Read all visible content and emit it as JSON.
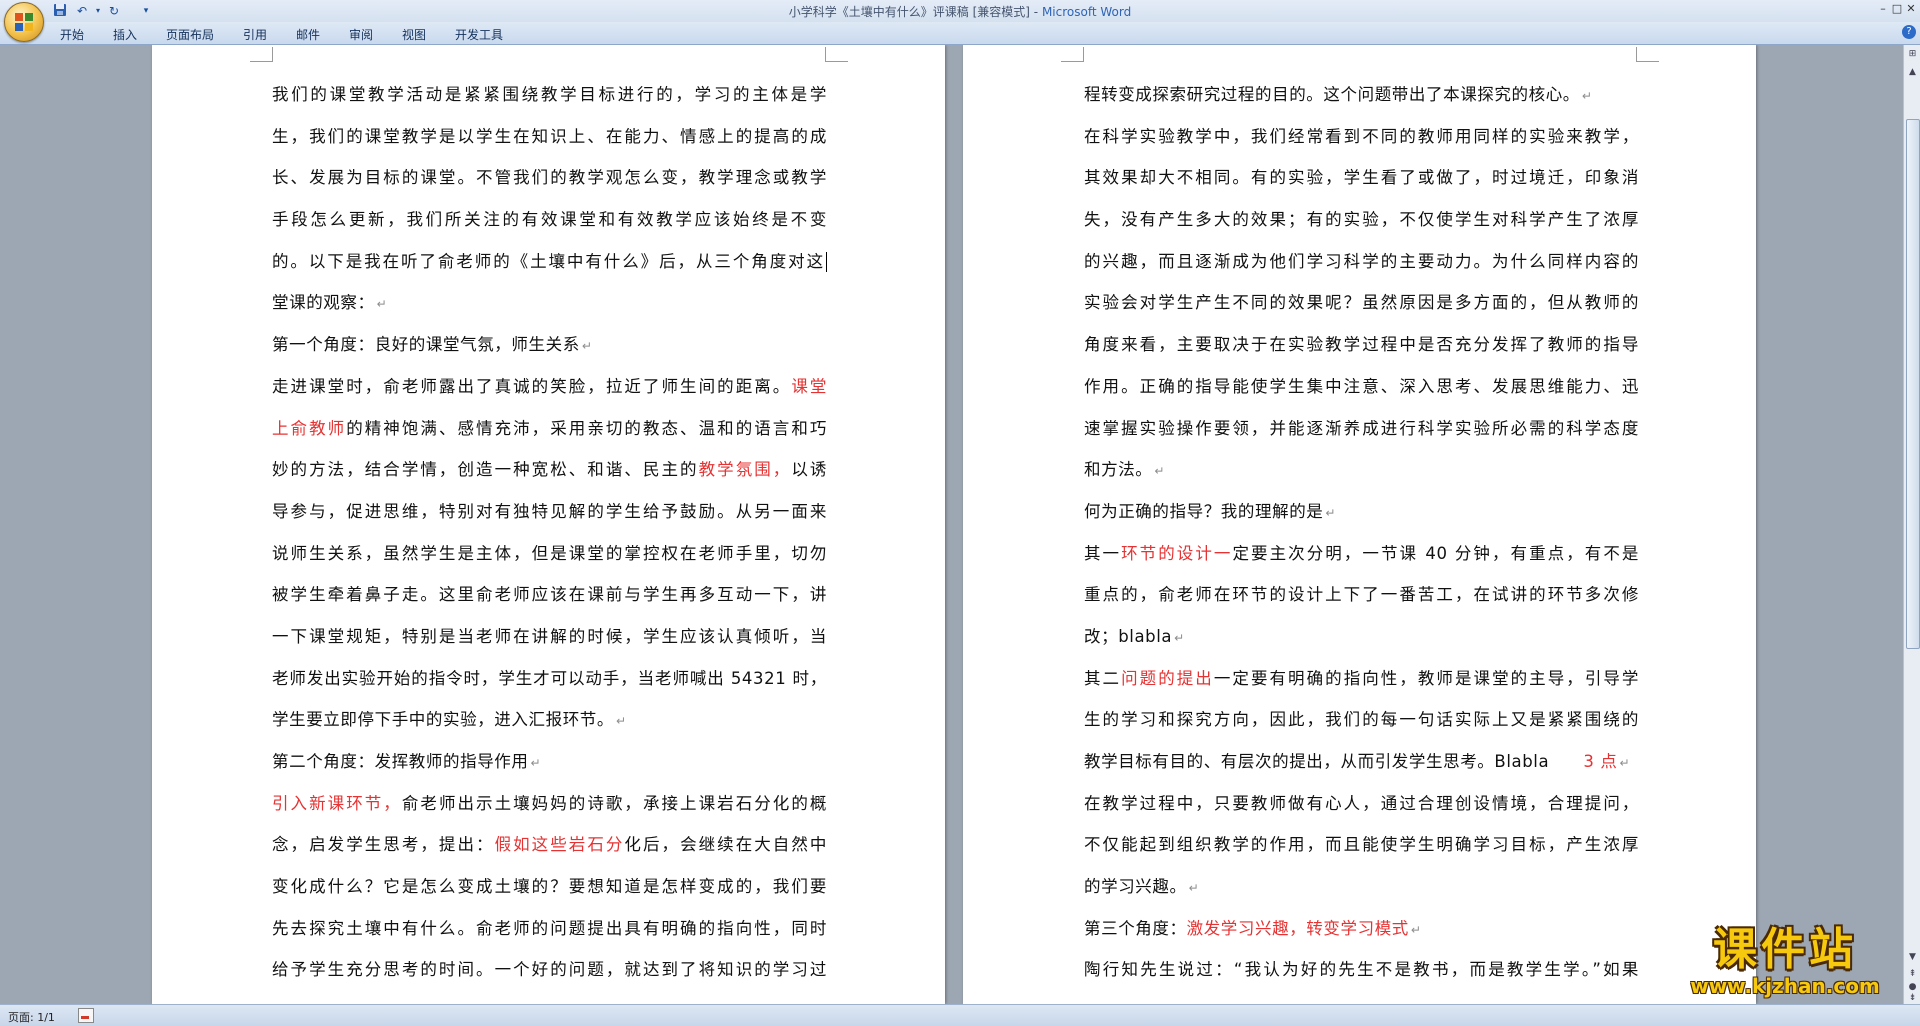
{
  "window": {
    "title": "小学科学《土壤中有什么》评课稿 [兼容模式]",
    "title_separator": " - ",
    "app_name": "Microsoft Word"
  },
  "quick_access": [
    {
      "icon": "save-icon",
      "glyph": "💾"
    },
    {
      "icon": "undo-icon",
      "glyph": "↶"
    },
    {
      "icon": "redo-icon",
      "glyph": "↻"
    },
    {
      "icon": "customize-toolbar-icon",
      "glyph": "▾"
    }
  ],
  "window_controls": {
    "minimize": "–",
    "restore": "□",
    "close": "✕"
  },
  "ribbon_tabs": [
    "开始",
    "插入",
    "页面布局",
    "引用",
    "邮件",
    "审阅",
    "视图",
    "开发工具"
  ],
  "document": {
    "left_page_lines": [
      {
        "j": true,
        "segs": [
          {
            "t": "我们的课堂教学活动是紧紧围绕教学目标进行的，学习的主体是学"
          }
        ]
      },
      {
        "j": true,
        "segs": [
          {
            "t": "生，我们的课堂教学是以学生在知识上、在能力、情感上的提高的成"
          }
        ]
      },
      {
        "j": true,
        "segs": [
          {
            "t": "长、发展为目标的课堂。不管我们的教学观怎么变，教学理念或教学"
          }
        ]
      },
      {
        "j": true,
        "segs": [
          {
            "t": "手段怎么更新，我们所关注的有效课堂和有效教学应该始终是不变"
          }
        ]
      },
      {
        "j": true,
        "cursor": true,
        "segs": [
          {
            "t": "的。以下是我在听了俞老师的《土壤中有什么》后，从三个角度对这"
          }
        ]
      },
      {
        "j": false,
        "pm": true,
        "segs": [
          {
            "t": "堂课的观察："
          }
        ]
      },
      {
        "j": false,
        "pm": true,
        "segs": [
          {
            "t": "第一个角度：良好的课堂气氛，师生关系"
          }
        ]
      },
      {
        "j": true,
        "segs": [
          {
            "t": "走进课堂时，俞老师露出了真诚的笑脸，拉近了师生间的距离。"
          },
          {
            "t": "课堂",
            "red": true
          }
        ]
      },
      {
        "j": true,
        "segs": [
          {
            "t": "上俞教师",
            "red": true
          },
          {
            "t": "的精神饱满、感情充沛，采用亲切的教态、温和的语言和巧"
          }
        ]
      },
      {
        "j": true,
        "segs": [
          {
            "t": "妙的方法，结合学情，创造一种宽松、和谐、民主的"
          },
          {
            "t": "教学氛围，",
            "red": true
          },
          {
            "t": "以诱"
          }
        ]
      },
      {
        "j": true,
        "segs": [
          {
            "t": "导参与，促进思维，特别对有独特见解的学生给予鼓励。从另一面来"
          }
        ]
      },
      {
        "j": true,
        "segs": [
          {
            "t": "说师生关系，虽然学生是主体，但是课堂的掌控权在老师手里，切勿"
          }
        ]
      },
      {
        "j": true,
        "segs": [
          {
            "t": "被学生牵着鼻子走。这里俞老师应该在课前与学生再多互动一下，讲"
          }
        ]
      },
      {
        "j": true,
        "segs": [
          {
            "t": "一下课堂规矩，特别是当老师在讲解的时候，学生应该认真倾听，当"
          }
        ]
      },
      {
        "j": true,
        "segs": [
          {
            "t": "老师发出实验开始的指令时，学生才可以动手，当老师喊出 54321 时，"
          }
        ]
      },
      {
        "j": false,
        "pm": true,
        "segs": [
          {
            "t": "学生要立即停下手中的实验，进入汇报环节。"
          }
        ]
      },
      {
        "j": false,
        "pm": true,
        "segs": [
          {
            "t": "第二个角度：发挥教师的指导作用"
          }
        ]
      },
      {
        "j": true,
        "segs": [
          {
            "t": "引入新课环节，",
            "red": true
          },
          {
            "t": "俞老师出示土壤妈妈的诗歌，承接上课岩石分化的概"
          }
        ]
      },
      {
        "j": true,
        "segs": [
          {
            "t": "念，启发学生思考，提出："
          },
          {
            "t": "假如这些岩石分",
            "red": true
          },
          {
            "t": "化后，会继续在大自然中"
          }
        ]
      },
      {
        "j": true,
        "segs": [
          {
            "t": "变化成什么？它是怎么变成土壤的？要想知道是怎样变成的，我们要"
          }
        ]
      },
      {
        "j": true,
        "segs": [
          {
            "t": "先去探究土壤中有什么。俞老师的问题提出具有明确的指向性，同时"
          }
        ]
      },
      {
        "j": true,
        "segs": [
          {
            "t": "给予学生充分思考的时间。一个好的问题，就达到了将知识的学习过"
          }
        ]
      }
    ],
    "right_page_lines": [
      {
        "j": false,
        "pm": true,
        "segs": [
          {
            "t": "程转变成探索研究过程的目的。这个问题带出了本课探究的核心。"
          }
        ]
      },
      {
        "j": true,
        "segs": [
          {
            "t": "在科学实验教学中，我们经常看到不同的教师用同样的实验来教学，"
          }
        ]
      },
      {
        "j": true,
        "segs": [
          {
            "t": "其效果却大不相同。有的实验，学生看了或做了，时过境迁，印象消"
          }
        ]
      },
      {
        "j": true,
        "segs": [
          {
            "t": "失，没有产生多大的效果；有的实验，不仅使学生对科学产生了浓厚"
          }
        ]
      },
      {
        "j": true,
        "segs": [
          {
            "t": "的兴趣，而且逐渐成为他们学习科学的主要动力。为什么同样内容的"
          }
        ]
      },
      {
        "j": true,
        "segs": [
          {
            "t": "实验会对学生产生不同的效果呢？虽然原因是多方面的，但从教师的"
          }
        ]
      },
      {
        "j": true,
        "segs": [
          {
            "t": "角度来看，主要取决于在实验教学过程中是否充分发挥了教师的指导"
          }
        ]
      },
      {
        "j": true,
        "segs": [
          {
            "t": "作用。正确的指导能使学生集中注意、深入思考、发展思维能力、迅"
          }
        ]
      },
      {
        "j": true,
        "segs": [
          {
            "t": "速掌握实验操作要领，并能逐渐养成进行科学实验所必需的科学态度"
          }
        ]
      },
      {
        "j": false,
        "pm": true,
        "segs": [
          {
            "t": "和方法。"
          }
        ]
      },
      {
        "j": false,
        "pm": true,
        "segs": [
          {
            "t": "何为正确的指导？我的理解的是"
          }
        ]
      },
      {
        "j": true,
        "segs": [
          {
            "t": "其一"
          },
          {
            "t": "环节的设计一",
            "red": true
          },
          {
            "t": "定要主次分明，一节课 40 分钟，有重点，有不是"
          }
        ]
      },
      {
        "j": true,
        "segs": [
          {
            "t": "重点的，俞老师在环节的设计上下了一番苦工，在试讲的环节多次修"
          }
        ]
      },
      {
        "j": false,
        "pm": true,
        "segs": [
          {
            "t": "改；blabla"
          }
        ]
      },
      {
        "j": true,
        "segs": [
          {
            "t": "其二"
          },
          {
            "t": "问题的提出",
            "red": true
          },
          {
            "t": "一定要有明确的指向性，教师是课堂的主导，引导学"
          }
        ]
      },
      {
        "j": true,
        "segs": [
          {
            "t": "生的学习和探究方向，因此，我们的每一句话实际上又是紧紧围绕的"
          }
        ]
      },
      {
        "j": false,
        "pm": true,
        "segs": [
          {
            "t": "教学目标有目的、有层次的提出，从而引发学生思考。Blabla　　"
          },
          {
            "t": "3 点",
            "red": true
          }
        ]
      },
      {
        "j": true,
        "segs": [
          {
            "t": "在教学过程中，只要教师做有心人，通过合理创设情境，合理提问，"
          }
        ]
      },
      {
        "j": true,
        "segs": [
          {
            "t": "不仅能起到组织教学的作用，而且能使学生明确学习目标，产生浓厚"
          }
        ]
      },
      {
        "j": false,
        "pm": true,
        "segs": [
          {
            "t": "的学习兴趣。"
          }
        ]
      },
      {
        "j": false,
        "pm": true,
        "segs": [
          {
            "t": "第三个角度："
          },
          {
            "t": "激发学习兴趣，转变学习模式",
            "red": true
          }
        ]
      },
      {
        "j": true,
        "segs": [
          {
            "t": "陶行知先生说过：“我认为好的先生不是教书，而是教学生学。”如果"
          }
        ]
      }
    ],
    "paragraph_mark": "↵"
  },
  "status_bar": {
    "page": "页面: 1/1"
  },
  "watermark": {
    "main": "课件站",
    "url": "www.kjzhan.com"
  },
  "colors": {
    "accent_red": "#e53232",
    "ribbon_text": "#15325c",
    "background": "#9da7b3"
  }
}
